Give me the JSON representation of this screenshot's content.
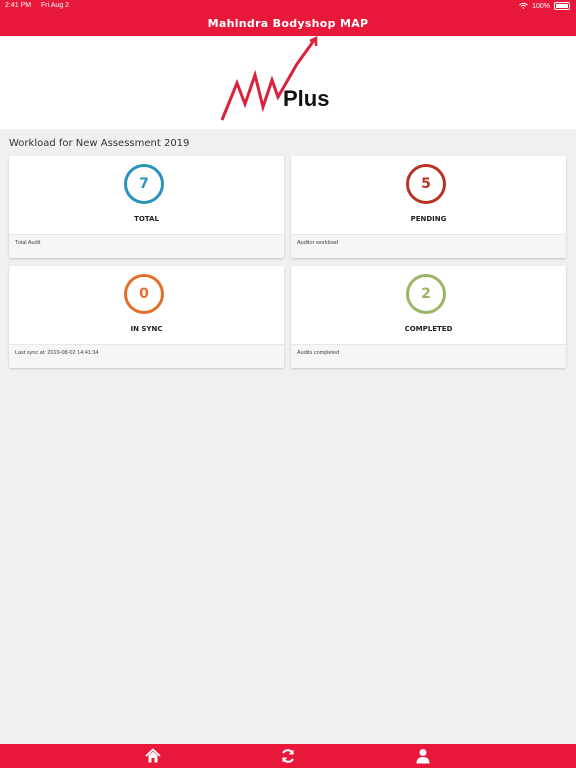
{
  "status_bar": {
    "time": "2:41 PM",
    "date": "Fri Aug 2",
    "battery": "100%"
  },
  "header": {
    "title": "Mahindra Bodyshop MAP"
  },
  "logo": {
    "text": "Plus"
  },
  "section": {
    "title": "Workload for New Assessment 2019"
  },
  "cards": [
    {
      "value": "7",
      "label": "TOTAL",
      "footer": "Total Audit",
      "color": "#2a93b7"
    },
    {
      "value": "5",
      "label": "PENDING",
      "footer": "Auditor workload",
      "color": "#b73425"
    },
    {
      "value": "0",
      "label": "IN SYNC",
      "footer": "Last sync at: 2019-08-02 14:41:34",
      "color": "#e2702a"
    },
    {
      "value": "2",
      "label": "COMPLETED",
      "footer": "Audits completed",
      "color": "#9bb466"
    }
  ],
  "tabbar": {
    "icons": [
      "home-icon",
      "sync-icon",
      "user-icon"
    ],
    "accent": "#e8183a"
  }
}
